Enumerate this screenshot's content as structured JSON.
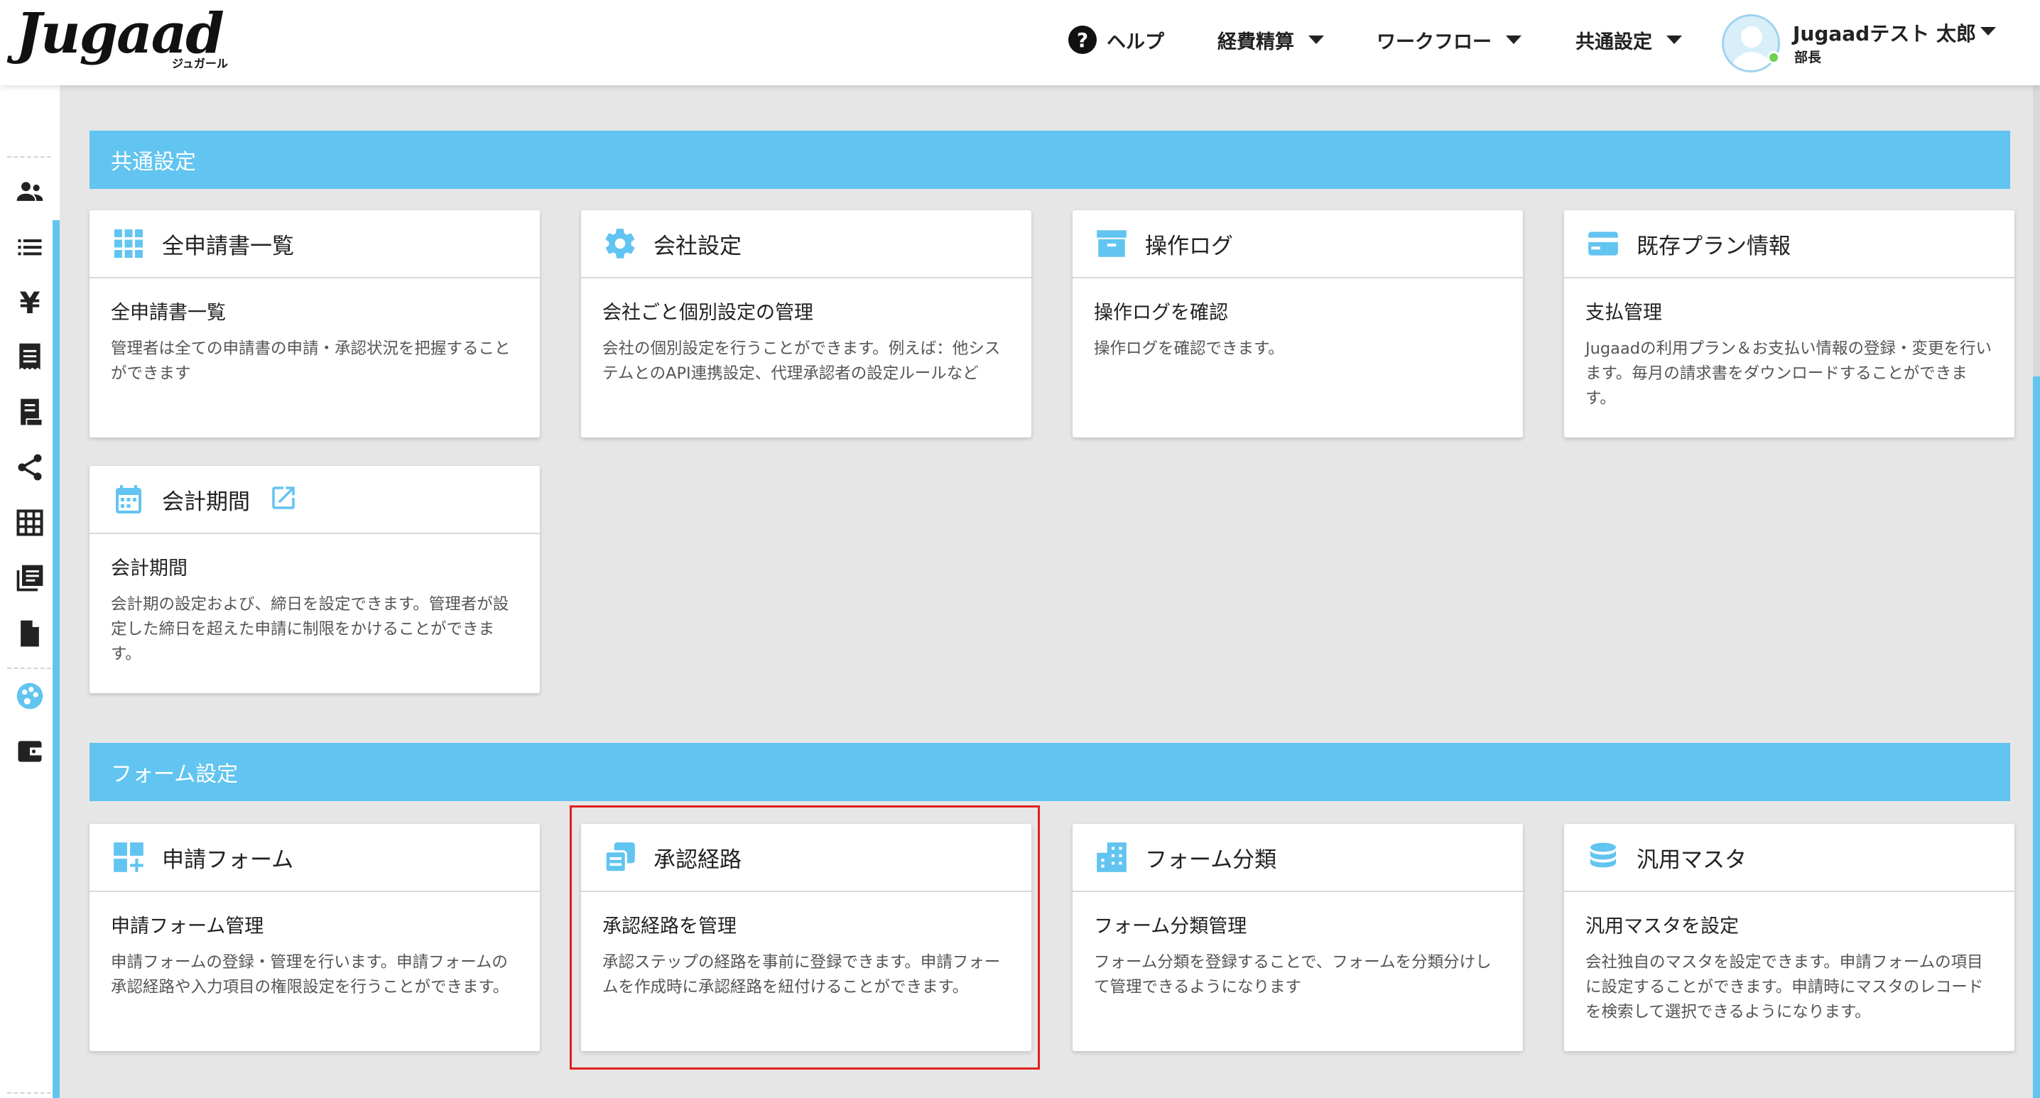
{
  "header": {
    "logo_text": "Jugaad",
    "logo_sub": "ジュガール",
    "nav": {
      "help": "ヘルプ",
      "expense": "経費精算",
      "workflow": "ワークフロー",
      "common_settings": "共通設定"
    },
    "user": {
      "name": "Jugaadテスト 太郎",
      "role": "部長",
      "status_color": "#6fcf4f"
    }
  },
  "colors": {
    "accent": "#62c4f0",
    "highlight": "#e02020",
    "background": "#e6e6e6"
  },
  "sidebar": {
    "icons": [
      "users-icon",
      "list-icon",
      "yen-icon",
      "receipt-icon",
      "invoice-icon",
      "share-icon",
      "grid-table-icon",
      "library-icon",
      "document-icon",
      "palette-icon",
      "wallet-icon"
    ],
    "active": "palette-icon"
  },
  "sections": {
    "common": {
      "title": "共通設定",
      "cards": [
        {
          "icon": "apps-grid-icon",
          "title": "全申請書一覧",
          "subtitle": "全申請書一覧",
          "desc": "管理者は全ての申請書の申請・承認状況を把握することができます"
        },
        {
          "icon": "gear-icon",
          "title": "会社設定",
          "subtitle": "会社ごと個別設定の管理",
          "desc": "会社の個別設定を行うことができます。例えば：他システムとのAPI連携設定、代理承認者の設定ルールなど"
        },
        {
          "icon": "archive-box-icon",
          "title": "操作ログ",
          "subtitle": "操作ログを確認",
          "desc": "操作ログを確認できます。"
        },
        {
          "icon": "credit-card-icon",
          "title": "既存プラン情報",
          "subtitle": "支払管理",
          "desc": "Jugaadの利用プラン＆お支払い情報の登録・変更を行います。毎月の請求書をダウンロードすることができます。"
        },
        {
          "icon": "calendar-icon",
          "title": "会計期間",
          "subtitle": "会計期間",
          "desc": "会計期の設定および、締日を設定できます。管理者が設定した締日を超えた申請に制限をかけることができます。",
          "external_link_icon": "external-link-icon"
        }
      ]
    },
    "form": {
      "title": "フォーム設定",
      "cards": [
        {
          "icon": "widgets-add-icon",
          "title": "申請フォーム",
          "subtitle": "申請フォーム管理",
          "desc": "申請フォームの登録・管理を行います。申請フォームの承認経路や入力項目の権限設定を行うことができます。"
        },
        {
          "icon": "route-copy-icon",
          "title": "承認経路",
          "subtitle": "承認経路を管理",
          "desc": "承認ステップの経路を事前に登録できます。申請フォームを作成時に承認経路を紐付けることができます。",
          "highlighted": true
        },
        {
          "icon": "building-icon",
          "title": "フォーム分類",
          "subtitle": "フォーム分類管理",
          "desc": "フォーム分類を登録することで、フォームを分類分けして管理できるようになります"
        },
        {
          "icon": "database-icon",
          "title": "汎用マスタ",
          "subtitle": "汎用マスタを設定",
          "desc": "会社独自のマスタを設定できます。申請フォームの項目に設定することができます。申請時にマスタのレコードを検索して選択できるようになります。"
        }
      ]
    }
  }
}
